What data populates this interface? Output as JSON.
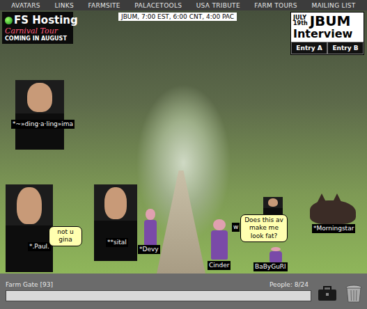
{
  "nav": {
    "items": [
      "AVATARS",
      "LINKS",
      "FARMSITE",
      "PALACETOOLS",
      "USA TRIBUTE",
      "FARM TOURS",
      "MAILING LIST"
    ]
  },
  "logo": {
    "title": "FS Hosting",
    "subtitle": "Carnival Tour",
    "tagline": "COMING IN AUGUST"
  },
  "banner": "JBUM, 7:00 EST, 6:00 CNT, 4:00 PAC",
  "interview": {
    "month": "JULY",
    "day": "19th",
    "title": "JBUM",
    "subtitle": "Interview",
    "entries": [
      "Entry A",
      "Entry B"
    ]
  },
  "avatars": [
    {
      "name": "*~»ding·a·ling»ima",
      "kind": "photo",
      "speech": ""
    },
    {
      "name": "*.Paul.",
      "kind": "photo",
      "speech": "not u gina"
    },
    {
      "name": "**sital",
      "kind": "photo",
      "speech": ""
    },
    {
      "name": "*Devy",
      "kind": "sprite",
      "speech": ""
    },
    {
      "name": "Cinder",
      "kind": "sprite",
      "speech": ""
    },
    {
      "name": "w",
      "kind": "photo",
      "speech": "Does this av make me look fat?"
    },
    {
      "name": "*Morningstar",
      "kind": "cat",
      "speech": ""
    },
    {
      "name": "BaByGuRl",
      "kind": "sprite",
      "speech": ""
    }
  ],
  "status_bar": {
    "room": "Farm Gate [93]",
    "people": "People: 8/24"
  },
  "chat_input": {
    "value": ""
  }
}
